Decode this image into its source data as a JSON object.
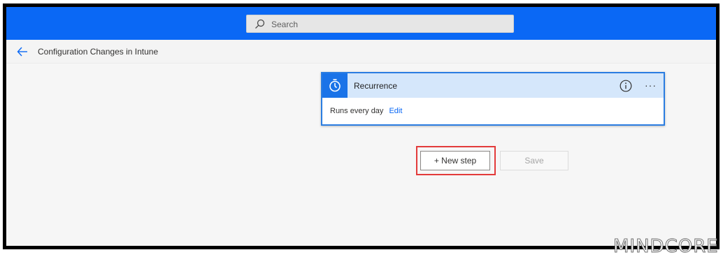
{
  "search": {
    "placeholder": "Search"
  },
  "header": {
    "flow_title": "Configuration Changes in Intune"
  },
  "trigger_card": {
    "title": "Recurrence",
    "description": "Runs every day",
    "edit_label": "Edit",
    "more_label": "···"
  },
  "actions": {
    "new_step_label": "+ New step",
    "save_label": "Save"
  },
  "watermark": {
    "text": "MINDCORE"
  },
  "colors": {
    "topbar": "#0a68f5",
    "card_header": "#d5e7fb",
    "card_border": "#2a7de1",
    "highlight": "#e33b3b"
  }
}
